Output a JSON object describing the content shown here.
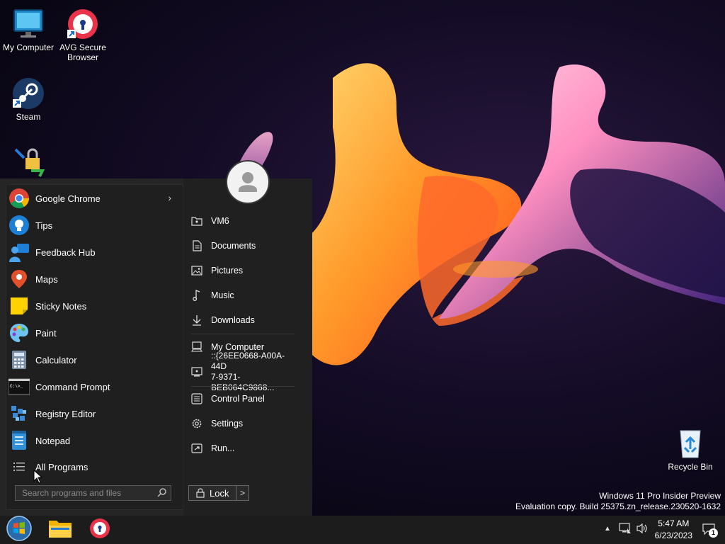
{
  "desktop": {
    "icons": [
      {
        "label": "My Computer",
        "icon": "monitor-icon"
      },
      {
        "label": "AVG Secure Browser",
        "icon": "avg-browser-icon"
      },
      {
        "label": "Steam",
        "icon": "steam-icon"
      },
      {
        "label": "Recycle Bin",
        "icon": "recycle-bin-icon"
      }
    ],
    "watermark": {
      "line1": "Windows 11 Pro Insider Preview",
      "line2": "Evaluation copy. Build 25375.zn_release.230520-1632"
    }
  },
  "start_menu": {
    "programs": [
      {
        "label": "Google Chrome",
        "icon": "chrome-icon",
        "has_submenu": true
      },
      {
        "label": "Tips",
        "icon": "tips-icon"
      },
      {
        "label": "Feedback Hub",
        "icon": "feedback-hub-icon"
      },
      {
        "label": "Maps",
        "icon": "maps-icon"
      },
      {
        "label": "Sticky Notes",
        "icon": "sticky-notes-icon"
      },
      {
        "label": "Paint",
        "icon": "paint-icon"
      },
      {
        "label": "Calculator",
        "icon": "calculator-icon"
      },
      {
        "label": "Command Prompt",
        "icon": "command-prompt-icon"
      },
      {
        "label": "Registry Editor",
        "icon": "registry-editor-icon"
      },
      {
        "label": "Notepad",
        "icon": "notepad-icon"
      }
    ],
    "all_programs": "All Programs",
    "search_placeholder": "Search programs and files",
    "right_items": {
      "user": "VM6",
      "documents": "Documents",
      "pictures": "Pictures",
      "music": "Music",
      "downloads": "Downloads",
      "my_computer": "My Computer",
      "guid_line1": "::{26EE0668-A00A-44D",
      "guid_line2": "7-9371-BEB064C9868...",
      "control_panel": "Control Panel",
      "settings": "Settings",
      "run": "Run..."
    },
    "lock_label": "Lock",
    "lock_arrow": ">"
  },
  "taskbar": {
    "items": [
      "start-orb-icon",
      "file-explorer-icon",
      "avg-browser-icon"
    ],
    "clock": {
      "time": "5:47 AM",
      "date": "6/23/2023"
    },
    "tray_up": "▲",
    "notification_count": "1"
  }
}
